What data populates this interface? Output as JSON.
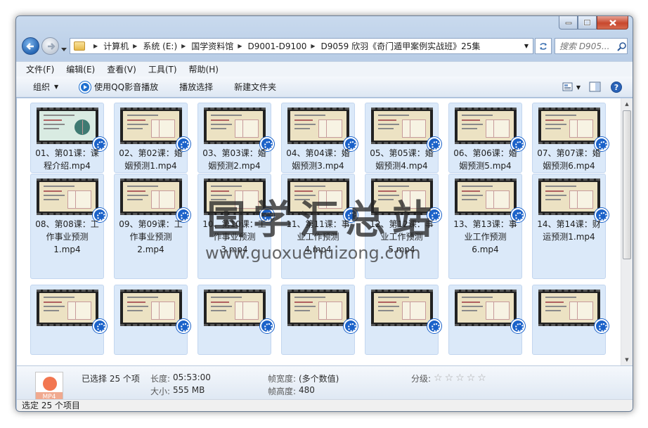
{
  "window": {
    "caption": {
      "minimize": "minimize",
      "maximize": "maximize",
      "close": "close"
    }
  },
  "address": {
    "crumbs": [
      "计算机",
      "系统 (E:)",
      "国学资料馆",
      "D9001-D9100",
      "D9059 欣羽《奇门遁甲案例实战班》25集"
    ],
    "search_placeholder": "搜索 D905..."
  },
  "menu": [
    "文件(F)",
    "编辑(E)",
    "查看(V)",
    "工具(T)",
    "帮助(H)"
  ],
  "toolbar": {
    "organize": "组织",
    "play_qq": "使用QQ影音播放",
    "play_selection": "播放选择",
    "new_folder": "新建文件夹"
  },
  "files": [
    {
      "line1": "01、第01课：课",
      "line2": "程介绍.mp4",
      "line3": ""
    },
    {
      "line1": "02、第02课：婚",
      "line2": "姻预测1.mp4",
      "line3": ""
    },
    {
      "line1": "03、第03课：婚",
      "line2": "姻预测2.mp4",
      "line3": ""
    },
    {
      "line1": "04、第04课：婚",
      "line2": "姻预测3.mp4",
      "line3": ""
    },
    {
      "line1": "05、第05课：婚",
      "line2": "姻预测4.mp4",
      "line3": ""
    },
    {
      "line1": "06、第06课：婚",
      "line2": "姻预测5.mp4",
      "line3": ""
    },
    {
      "line1": "07、第07课：婚",
      "line2": "姻预测6.mp4",
      "line3": ""
    },
    {
      "line1": "08、第08课：工",
      "line2": "作事业预测",
      "line3": "1.mp4"
    },
    {
      "line1": "09、第09课：工",
      "line2": "作事业预测",
      "line3": "2.mp4"
    },
    {
      "line1": "10、第10课：工",
      "line2": "作事业预测",
      "line3": "3.mp4"
    },
    {
      "line1": "11、第11课：事",
      "line2": "业工作预测",
      "line3": "4.mp4"
    },
    {
      "line1": "12、第12课：事",
      "line2": "业工作预测",
      "line3": "5.mp4"
    },
    {
      "line1": "13、第13课：事",
      "line2": "业工作预测",
      "line3": "6.mp4"
    },
    {
      "line1": "14、第14课：财",
      "line2": "运预测1.mp4",
      "line3": ""
    },
    {
      "line1": "",
      "line2": "",
      "line3": ""
    },
    {
      "line1": "",
      "line2": "",
      "line3": ""
    },
    {
      "line1": "",
      "line2": "",
      "line3": ""
    },
    {
      "line1": "",
      "line2": "",
      "line3": ""
    },
    {
      "line1": "",
      "line2": "",
      "line3": ""
    },
    {
      "line1": "",
      "line2": "",
      "line3": ""
    },
    {
      "line1": "",
      "line2": "",
      "line3": ""
    }
  ],
  "watermark": {
    "title": "国学汇总站",
    "url": "www.guoxuehuizong.com"
  },
  "details": {
    "selected": "已选择 25 个项",
    "length_label": "长度:",
    "length_value": "05:53:00",
    "size_label": "大小:",
    "size_value": "555 MB",
    "frame_width_label": "帧宽度:",
    "frame_width_value": "(多个数值)",
    "frame_height_label": "帧高度:",
    "frame_height_value": "480",
    "rating_label": "分级:",
    "rating_stars": 0,
    "icon_label": "MP4"
  },
  "status": {
    "text": "选定 25 个项目"
  }
}
